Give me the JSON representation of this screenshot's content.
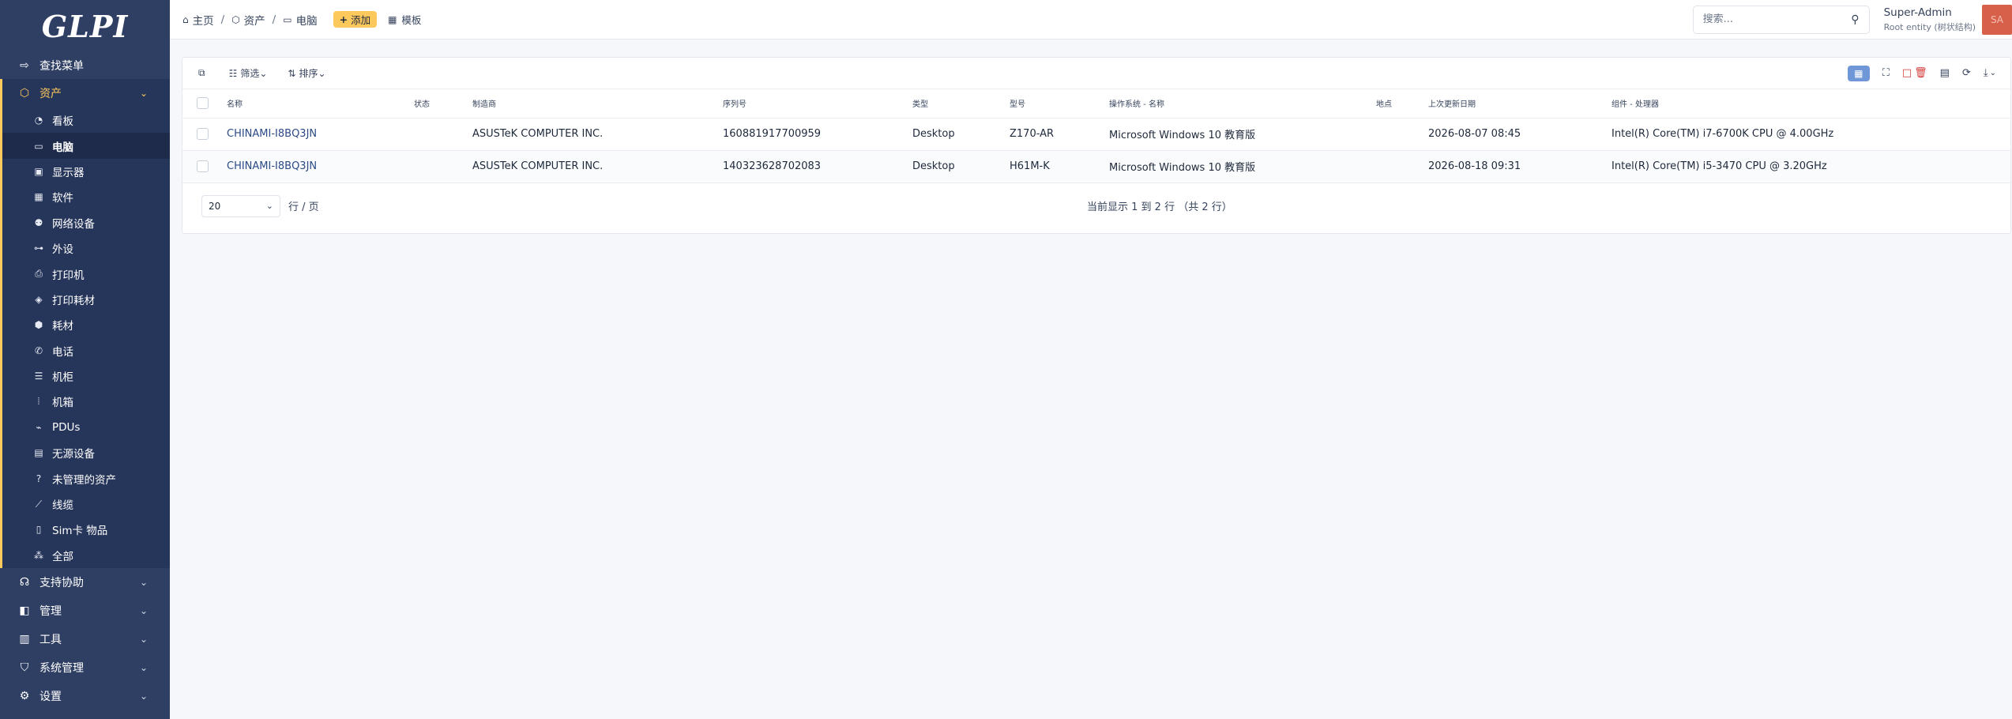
{
  "app": {
    "logo": "GLPI"
  },
  "sidebar": {
    "find_menu": "查找菜单",
    "assets": {
      "label": "资产",
      "items": [
        {
          "label": "看板",
          "icon": "dashboard-icon"
        },
        {
          "label": "电脑",
          "icon": "laptop-icon"
        },
        {
          "label": "显示器",
          "icon": "monitor-icon"
        },
        {
          "label": "软件",
          "icon": "apps-icon"
        },
        {
          "label": "网络设备",
          "icon": "network-icon"
        },
        {
          "label": "外设",
          "icon": "usb-icon"
        },
        {
          "label": "打印机",
          "icon": "printer-icon"
        },
        {
          "label": "打印耗材",
          "icon": "droplet-icon"
        },
        {
          "label": "耗材",
          "icon": "package-icon"
        },
        {
          "label": "电话",
          "icon": "phone-icon"
        },
        {
          "label": "机柜",
          "icon": "server-icon"
        },
        {
          "label": "机箱",
          "icon": "columns-icon"
        },
        {
          "label": "PDUs",
          "icon": "plug-icon"
        },
        {
          "label": "无源设备",
          "icon": "box-icon"
        },
        {
          "label": "未管理的资产",
          "icon": "question-icon"
        },
        {
          "label": "线缆",
          "icon": "cable-icon"
        },
        {
          "label": "Sim卡 物品",
          "icon": "file-icon"
        },
        {
          "label": "全部",
          "icon": "all-assets-icon"
        }
      ]
    },
    "categories": [
      {
        "label": "支持协助",
        "icon": "headset-icon"
      },
      {
        "label": "管理",
        "icon": "wallet-icon"
      },
      {
        "label": "工具",
        "icon": "briefcase-icon"
      },
      {
        "label": "系统管理",
        "icon": "shield-icon"
      },
      {
        "label": "设置",
        "icon": "gear-icon"
      }
    ]
  },
  "header": {
    "breadcrumbs": [
      "主页",
      "资产",
      "电脑"
    ],
    "add_label": "添加",
    "template_label": "模板",
    "search_placeholder": "搜索...",
    "user_name": "Super-Admin",
    "user_entity": "Root entity (树状结构)",
    "avatar_initials": "SA"
  },
  "toolbar": {
    "filter_label": "筛选",
    "sort_label": "排序"
  },
  "table": {
    "columns": [
      "名称",
      "状态",
      "制造商",
      "序列号",
      "类型",
      "型号",
      "操作系统 - 名称",
      "地点",
      "上次更新日期",
      "组件 - 处理器"
    ],
    "rows": [
      {
        "name": "CHINAMI-I8BQ3JN",
        "status": "",
        "manufacturer": "ASUSTeK COMPUTER INC.",
        "serial": "160881917700959",
        "type": "Desktop",
        "model": "Z170-AR",
        "os": "Microsoft Windows 10 教育版",
        "location": "",
        "updated": "2026-08-07 08:45",
        "processor": "Intel(R) Core(TM) i7-6700K CPU @ 4.00GHz"
      },
      {
        "name": "CHINAMI-I8BQ3JN",
        "status": "",
        "manufacturer": "ASUSTeK COMPUTER INC.",
        "serial": "140323628702083",
        "type": "Desktop",
        "model": "H61M-K",
        "os": "Microsoft Windows 10 教育版",
        "location": "",
        "updated": "2026-08-18 09:31",
        "processor": "Intel(R) Core(TM) i5-3470 CPU @ 3.20GHz"
      }
    ]
  },
  "pager": {
    "per_page_value": "20",
    "per_page_label": "行 / 页",
    "info": "当前显示 1 到 2 行 （共 2 行）"
  },
  "colors": {
    "sidebar_bg": "#2f3f64",
    "accent": "#fec95c",
    "link": "#2c4a86",
    "danger": "#d63939"
  }
}
